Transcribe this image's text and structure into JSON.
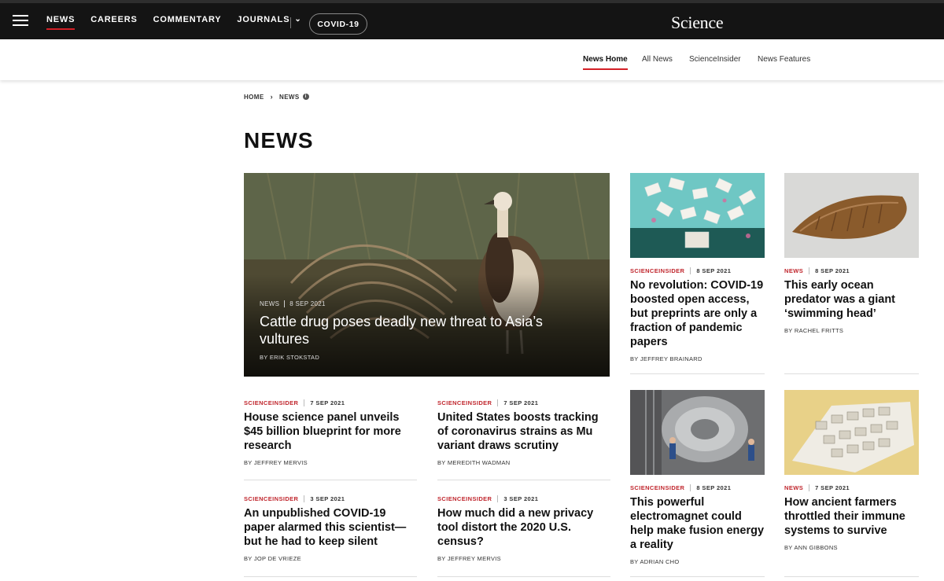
{
  "topnav": {
    "items": [
      {
        "label": "NEWS",
        "active": true
      },
      {
        "label": "CAREERS",
        "active": false
      },
      {
        "label": "COMMENTARY",
        "active": false
      },
      {
        "label": "JOURNALS",
        "active": false
      }
    ],
    "covid_label": "COVID-19",
    "logo": "Science"
  },
  "subnav": {
    "items": [
      {
        "label": "News Home",
        "active": true
      },
      {
        "label": "All News",
        "active": false
      },
      {
        "label": "ScienceInsider",
        "active": false
      },
      {
        "label": "News Features",
        "active": false
      }
    ]
  },
  "breadcrumb": {
    "home": "HOME",
    "current": "NEWS"
  },
  "page_title": "NEWS",
  "hero": {
    "category": "NEWS",
    "date": "8 SEP 2021",
    "title": "Cattle drug poses deadly new threat to Asia’s vultures",
    "author": "BY ERIK STOKSTAD"
  },
  "left_cards": [
    {
      "category": "SCIENCEINSIDER",
      "date": "7 SEP 2021",
      "title": "House science panel unveils $45 billion blueprint for more research",
      "author": "BY JEFFREY MERVIS"
    },
    {
      "category": "SCIENCEINSIDER",
      "date": "7 SEP 2021",
      "title": "United States boosts tracking of coronavirus strains as Mu variant draws scrutiny",
      "author": "BY MEREDITH WADMAN"
    },
    {
      "category": "SCIENCEINSIDER",
      "date": "3 SEP 2021",
      "title": "An unpublished COVID-19 paper alarmed this scientist—but he had to keep silent",
      "author": "BY JOP DE VRIEZE"
    },
    {
      "category": "SCIENCEINSIDER",
      "date": "3 SEP 2021",
      "title": "How much did a new privacy tool distort the 2020 U.S. census?",
      "author": "BY JEFFREY MERVIS"
    }
  ],
  "right_cards": [
    {
      "category": "SCIENCEINSIDER",
      "date": "8 SEP 2021",
      "title": "No revolution: COVID-19 boosted open access, but preprints are only a fraction of pandemic papers",
      "author": "BY JEFFREY BRAINARD",
      "image": "paper-storm-illustration"
    },
    {
      "category": "NEWS",
      "date": "8 SEP 2021",
      "title": "This early ocean predator was a giant ‘swimming head’",
      "author": "BY RACHEL FRITTS",
      "image": "ancient-arthropod-head"
    },
    {
      "category": "SCIENCEINSIDER",
      "date": "8 SEP 2021",
      "title": "This powerful electromagnet could help make fusion energy a reality",
      "author": "BY ADRIAN CHO",
      "image": "fusion-magnet-photo"
    },
    {
      "category": "NEWS",
      "date": "7 SEP 2021",
      "title": "How ancient farmers throttled their immune systems to survive",
      "author": "BY ANN GIBBONS",
      "image": "ancient-village-illustration"
    }
  ],
  "colors": {
    "accent": "#d31f26",
    "kicker": "#c0262d",
    "topbar": "#141414"
  }
}
